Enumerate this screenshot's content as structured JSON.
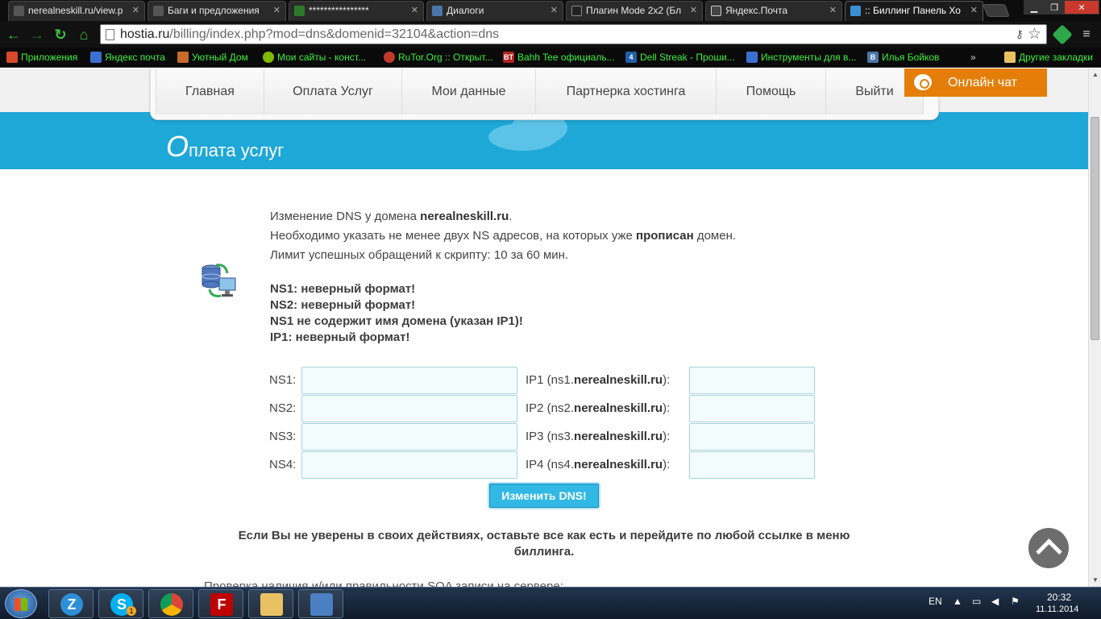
{
  "browser": {
    "tabs": [
      {
        "label": "nerealneskill.ru/view.p",
        "icon_color": "#555555",
        "active": false
      },
      {
        "label": "Баги и предложения",
        "icon_color": "#555555",
        "active": false
      },
      {
        "label": "****************",
        "icon_color": "#2b7a2b",
        "active": false
      },
      {
        "label": "Диалоги",
        "icon_color": "#4a76a8",
        "active": false
      },
      {
        "label": "Плагин Mode 2x2 (Бл",
        "icon_color": "#222222",
        "active": false
      },
      {
        "label": "Яндекс.Почта",
        "icon_color": "#444444",
        "active": false
      },
      {
        "label": ":: Биллинг Панель Хо",
        "icon_color": "#3a8fd0",
        "active": true
      }
    ],
    "url_domain": "hostia.ru",
    "url_path": "/billing/index.php?mod=dns&domenid=32104&action=dns",
    "bookmarks": [
      {
        "label": "Приложения",
        "icon_color": "#d9482b",
        "icon_glyph": ""
      },
      {
        "label": "Яндекс почта",
        "icon_color": "#3b6fd1",
        "icon_glyph": ""
      },
      {
        "label": "Уютный Дом",
        "icon_color": "#c76b2b",
        "icon_glyph": ""
      },
      {
        "label": "Мои сайты - конст...",
        "icon_color": "#7fba00",
        "icon_glyph": ""
      },
      {
        "label": "RuTor.Org :: Открыт...",
        "icon_color": "#c0392b",
        "icon_glyph": ""
      },
      {
        "label": "Bahh Tee официаль...",
        "icon_color": "#b22222",
        "icon_glyph": "BT"
      },
      {
        "label": "Dell Streak - Проши...",
        "icon_color": "#1f5fa8",
        "icon_glyph": "4"
      },
      {
        "label": "Инструменты для в...",
        "icon_color": "#3b6fd1",
        "icon_glyph": ""
      },
      {
        "label": "Илья Бойков",
        "icon_color": "#4a76a8",
        "icon_glyph": "B"
      }
    ],
    "bookmarks_overflow": "»",
    "other_bookmarks": "Другие закладки"
  },
  "site": {
    "menu": [
      "Главная",
      "Оплата Услуг",
      "Мои данные",
      "Партнерка хостинга",
      "Помощь",
      "Выйти"
    ],
    "chat_button": "Онлайн чат",
    "title_first": "О",
    "title_rest": "плата услуг"
  },
  "content": {
    "line1_pre": "Изменение DNS у домена ",
    "domain": "nerealneskill.ru",
    "line1_post": ".",
    "line2_pre": "Необходимо указать не менее двух NS адресов, на которых уже ",
    "line2_bold": "прописан",
    "line2_post": " домен.",
    "line3": "Лимит успешных обращений к скрипту: 10 за 60 мин.",
    "errors": [
      "NS1: неверный формат!",
      "NS2: неверный формат!",
      "NS1 не содержит имя домена (указан IP1)!",
      "IP1: неверный формат!"
    ],
    "form_rows": [
      {
        "ns_label": "NS1:",
        "ip_pre": "IP1 (ns1.",
        "ip_post": "):",
        "ns_value": "",
        "ip_value": ""
      },
      {
        "ns_label": "NS2:",
        "ip_pre": "IP2 (ns2.",
        "ip_post": "):",
        "ns_value": "",
        "ip_value": ""
      },
      {
        "ns_label": "NS3:",
        "ip_pre": "IP3 (ns3.",
        "ip_post": "):",
        "ns_value": "",
        "ip_value": ""
      },
      {
        "ns_label": "NS4:",
        "ip_pre": "IP4 (ns4.",
        "ip_post": "):",
        "ns_value": "",
        "ip_value": ""
      }
    ],
    "submit_label": "Изменить DNS!",
    "warning": "Если Вы не уверены в своих действиях, оставьте все как есть и перейдите по любой ссылке в меню биллинга.",
    "cutoff_text": "Проверка наличия и/или правильности SOA записи на сервере:"
  },
  "taskbar": {
    "language": "EN",
    "time": "20:32",
    "date": "11.11.2014",
    "skype_badge": "1"
  },
  "colors": {
    "accent_blue": "#1ea8d8",
    "chat_orange": "#e47e08",
    "bookmark_green": "#3df03d"
  }
}
